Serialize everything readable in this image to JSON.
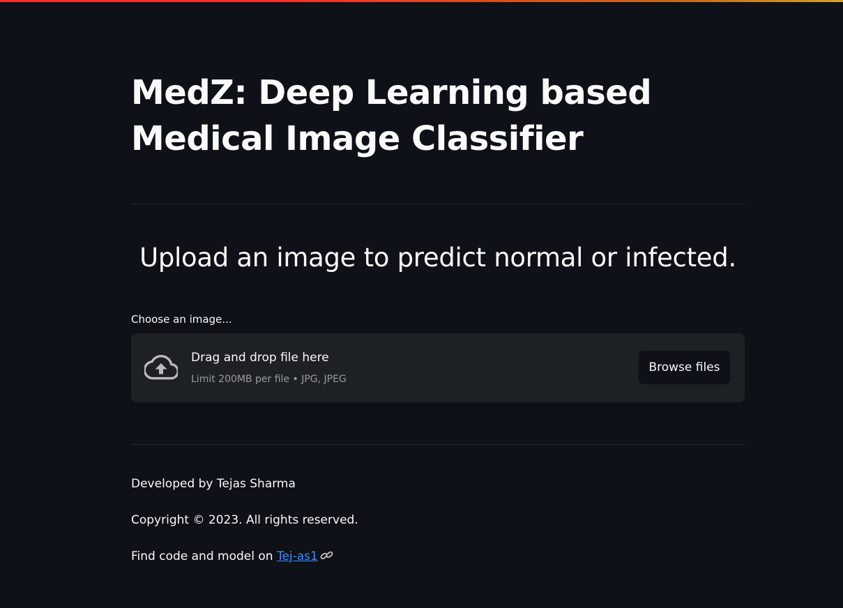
{
  "page": {
    "title": "MedZ: Deep Learning based Medical Image Classifier",
    "subheader": "Upload an image to predict normal or infected."
  },
  "uploader": {
    "label": "Choose an image...",
    "drop_text": "Drag and drop file here",
    "limit_text": "Limit 200MB per file • JPG, JPEG",
    "browse_label": "Browse files",
    "icon": "cloud-upload-icon"
  },
  "footer": {
    "developer": "Developed by Tejas Sharma",
    "copyright": "Copyright © 2023. All rights reserved.",
    "code_prefix": "Find code and model on ",
    "code_link_label": "Tej-as1",
    "link_icon": "link-icon"
  },
  "colors": {
    "background": "#0e1117",
    "text": "#fafafa",
    "dropzone_bg": "#1e2124",
    "muted_text": "#9a9ca3",
    "link": "#3b8cff",
    "accent_start": "#ff2b2b",
    "accent_end": "#d4a02a"
  }
}
